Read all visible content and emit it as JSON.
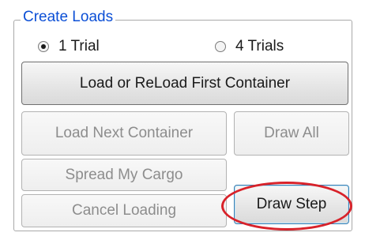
{
  "group": {
    "title": "Create Loads"
  },
  "radios": [
    {
      "label": "1 Trial",
      "checked": true
    },
    {
      "label": "4 Trials",
      "checked": false
    }
  ],
  "buttons": {
    "load_first": {
      "label": "Load or ReLoad First Container",
      "enabled": true
    },
    "load_next": {
      "label": "Load Next Container",
      "enabled": false
    },
    "draw_all": {
      "label": "Draw All",
      "enabled": false
    },
    "spread_cargo": {
      "label": "Spread My Cargo",
      "enabled": false
    },
    "cancel_loading": {
      "label": "Cancel Loading",
      "enabled": false
    },
    "draw_step": {
      "label": "Draw Step",
      "enabled": true,
      "highlighted": true
    }
  },
  "colors": {
    "group_title": "#0b4fd6",
    "highlight": "#d8222a",
    "disabled_text": "#8d8d8d"
  }
}
